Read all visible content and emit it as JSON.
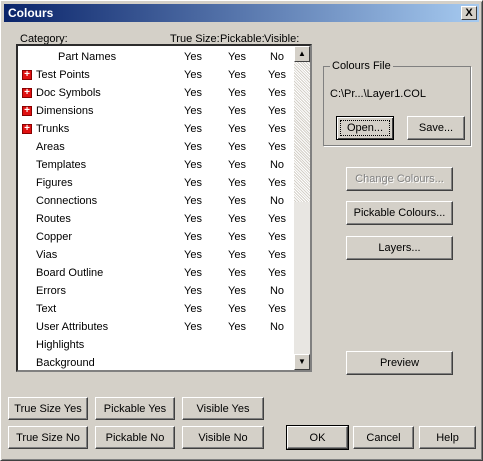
{
  "window": {
    "title": "Colours",
    "close_label": "X"
  },
  "headers": {
    "category": "Category:",
    "true_size": "True Size:",
    "pickable": "Pickable:",
    "visible": "Visible:"
  },
  "rows": [
    {
      "name": "Part Names",
      "expandable": false,
      "indent": "deep",
      "true_size": "Yes",
      "pickable": "Yes",
      "visible": "No"
    },
    {
      "name": "Test Points",
      "expandable": true,
      "true_size": "Yes",
      "pickable": "Yes",
      "visible": "Yes"
    },
    {
      "name": "Doc Symbols",
      "expandable": true,
      "true_size": "Yes",
      "pickable": "Yes",
      "visible": "Yes"
    },
    {
      "name": "Dimensions",
      "expandable": true,
      "true_size": "Yes",
      "pickable": "Yes",
      "visible": "Yes"
    },
    {
      "name": "Trunks",
      "expandable": true,
      "true_size": "Yes",
      "pickable": "Yes",
      "visible": "Yes"
    },
    {
      "name": "Areas",
      "expandable": false,
      "true_size": "Yes",
      "pickable": "Yes",
      "visible": "Yes"
    },
    {
      "name": "Templates",
      "expandable": false,
      "true_size": "Yes",
      "pickable": "Yes",
      "visible": "No"
    },
    {
      "name": "Figures",
      "expandable": false,
      "true_size": "Yes",
      "pickable": "Yes",
      "visible": "Yes"
    },
    {
      "name": "Connections",
      "expandable": false,
      "true_size": "Yes",
      "pickable": "Yes",
      "visible": "No"
    },
    {
      "name": "Routes",
      "expandable": false,
      "true_size": "Yes",
      "pickable": "Yes",
      "visible": "Yes"
    },
    {
      "name": "Copper",
      "expandable": false,
      "true_size": "Yes",
      "pickable": "Yes",
      "visible": "Yes"
    },
    {
      "name": "Vias",
      "expandable": false,
      "true_size": "Yes",
      "pickable": "Yes",
      "visible": "Yes"
    },
    {
      "name": "Board Outline",
      "expandable": false,
      "true_size": "Yes",
      "pickable": "Yes",
      "visible": "Yes"
    },
    {
      "name": "Errors",
      "expandable": false,
      "true_size": "Yes",
      "pickable": "Yes",
      "visible": "No"
    },
    {
      "name": "Text",
      "expandable": false,
      "true_size": "Yes",
      "pickable": "Yes",
      "visible": "Yes"
    },
    {
      "name": "User Attributes",
      "expandable": false,
      "true_size": "Yes",
      "pickable": "Yes",
      "visible": "No"
    },
    {
      "name": "Highlights",
      "expandable": false,
      "true_size": "",
      "pickable": "",
      "visible": ""
    },
    {
      "name": "Background",
      "expandable": false,
      "true_size": "",
      "pickable": "",
      "visible": ""
    }
  ],
  "colours_file": {
    "title": "Colours File",
    "path": "C:\\Pr...\\Layer1.COL",
    "open_label": "Open...",
    "save_label": "Save..."
  },
  "side_buttons": {
    "change_colours": "Change Colours...",
    "pickable_colours": "Pickable Colours...",
    "layers": "Layers...",
    "preview": "Preview"
  },
  "bottom_buttons": {
    "true_size_yes": "True Size Yes",
    "pickable_yes": "Pickable Yes",
    "visible_yes": "Visible Yes",
    "true_size_no": "True Size No",
    "pickable_no": "Pickable No",
    "visible_no": "Visible No",
    "ok": "OK",
    "cancel": "Cancel",
    "help": "Help"
  },
  "colors": {
    "titlebar_start": "#0a246a",
    "titlebar_end": "#a6caf0",
    "expand_icon": "#e01010",
    "dialog_bg": "#d4d0c8"
  },
  "icons": {
    "expand": "plus-box-icon",
    "close": "close-icon",
    "scroll_up": "arrow-up-icon",
    "scroll_down": "arrow-down-icon"
  }
}
